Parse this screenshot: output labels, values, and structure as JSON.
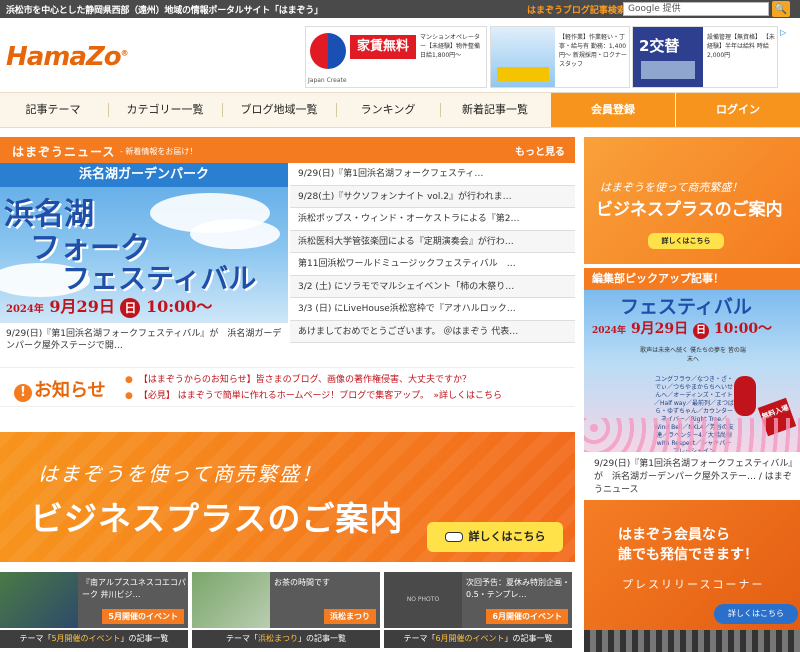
{
  "topbar": {
    "tagline": "浜松市を中心とした静岡県西部（遠州）地域の情報ポータルサイト「はまぞう」",
    "blog_search": "はまぞうブログ記事検索",
    "search_placeholder": "Google 提供",
    "search_button": "🔍"
  },
  "header": {
    "logo": "HamaZo",
    "ads": [
      {
        "brand": "Japan Create",
        "headline": "家賃無料",
        "text": "マンションオペレーター【未経験】物件整備 日給1,800円〜"
      },
      {
        "brand": "",
        "headline": "",
        "text": "【軽作業】作業軽い・丁寧・給与有 勤務：1,400円〜 新規採用・ロクナースタッフ"
      },
      {
        "brand": "",
        "headline": "2交替",
        "text": "設備管理【無資格】 【未経験】半年は給料 時給2,000円"
      }
    ]
  },
  "nav": {
    "items": [
      "記事テーマ",
      "カテゴリー一覧",
      "ブログ地域一覧",
      "ランキング",
      "新着記事一覧"
    ],
    "register": "会員登録",
    "login": "ログイン"
  },
  "news": {
    "title": "はまぞうニュース",
    "subtitle": "- 新着情報をお届け！",
    "more": "もっと見る",
    "hero": {
      "band": "浜名湖ガーデンパーク",
      "line1": "浜名湖",
      "line2": "フォーク",
      "line3": "フェスティバル",
      "year": "2024年",
      "date": "9月29日",
      "weekday": "日",
      "time": "10:00〜"
    },
    "caption": "9/29(日)『第1回浜名湖フォークフェスティバル』が　浜名湖ガーデンパーク屋外ステージで開…",
    "items": [
      "9/29(日)『第1回浜名湖フォークフェスティ…",
      "9/28(土)『サクソフォンナイト vol.2』が行われま…",
      "浜松ポップス・ウィンド・オーケストラによる『第2…",
      "浜松医科大学管弦楽団による『定期演奏会』が行わ…",
      "第11回浜松ワールドミュージックフェスティバル　…",
      "3/2 (土) にソラモでマルシェイベント「柿の木祭り…",
      "3/3 (日) にLiveHouse浜松窓枠で『アオハルロック…",
      "あけましておめでとうございます。 ＠はまぞう 代表…"
    ]
  },
  "notice": {
    "label": "お知らせ",
    "lines": [
      "【はまぞうからのお知らせ】皆さまのブログ、画像の著作権侵害、大丈夫ですか？",
      "【必見】 はまぞうで簡単に作れるホームページ！ブログで集客アップ。　»詳しくはこちら"
    ]
  },
  "business_banner": {
    "line1": "はまぞうを使って商売繁盛！",
    "line2": "ビジネスプラスのご案内",
    "button": "詳しくはこちら"
  },
  "events": [
    {
      "text": "『南アルプスユネスコエコパーク 井川ビジ…",
      "tag": "5月開催のイベント",
      "footer_pre": "テーマ「",
      "footer_theme": "5月開催のイベント",
      "footer_post": "」の記事一覧"
    },
    {
      "text": "お茶の時間です",
      "tag": "浜松まつり",
      "footer_pre": "テーマ「",
      "footer_theme": "浜松まつり",
      "footer_post": "」の記事一覧"
    },
    {
      "text": "次回予告：夏休み特別企画・0.5・テンプレ…",
      "tag": "6月開催のイベント",
      "no_photo": "NO PHOTO",
      "footer_pre": "テーマ「",
      "footer_theme": "6月開催のイベント",
      "footer_post": "」の記事一覧"
    }
  ],
  "sidebar": {
    "biz": {
      "line1": "はまぞうを使って商売繁盛！",
      "line2": "ビジネスプラスのご案内",
      "button": "詳しくはこちら"
    },
    "pickup": {
      "title": "編集部ピックアップ記事！",
      "img_title": "フェスティバル",
      "year": "2024年",
      "date": "9月29日",
      "weekday": "日",
      "time": "10:00〜",
      "sub": "歌声は未来へ続く 僕たちの夢を 皆の端末へ",
      "lineup": "ユングフラウ／なつき・ざ・でぃ／つちやまからちへいせんへ／オーディンズ・エイト／Half way／最前列／まつばら・ゆずちゃん／カウンターネイバー／Right Tree／Wind Bell／NKL4／芳谷の友達／ラベンダー4／大橋尚樹with Respect／シャキパープレッシャイン",
      "badge": "無料入場",
      "caption": "9/29(日)『第1回浜名湖フォークフェスティバル』が　浜名湖ガーデンパーク屋外ステー… / はまぞうニュース"
    },
    "member": {
      "line1": "はまぞう会員なら",
      "line2": "誰でも発信できます！",
      "line3": "プレスリリースコーナー",
      "button": "詳しくはこちら"
    }
  },
  "colors": {
    "accent": "#f47b1f",
    "dark": "#4a4a4a",
    "blue": "#2a7fd0"
  }
}
